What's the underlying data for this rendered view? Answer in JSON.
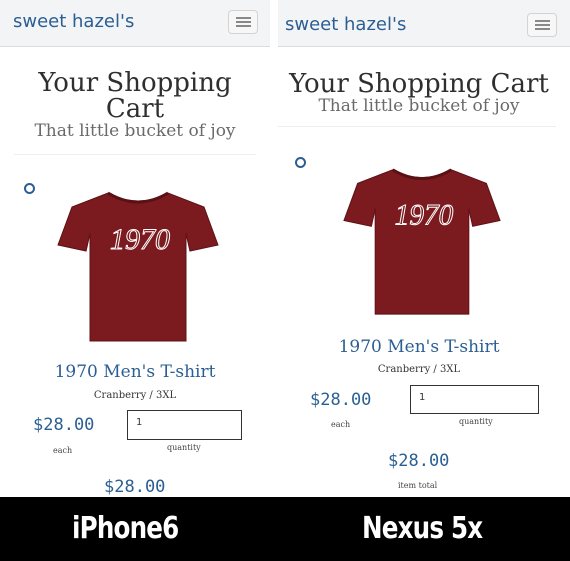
{
  "brand": "sweet hazel's",
  "cart_title": "Your Shopping Cart",
  "cart_title_line1": "Your Shopping",
  "cart_title_line2": "Cart",
  "cart_subtitle": "That little bucket of joy",
  "product": {
    "name": "1970 Men's T-shirt",
    "variant": "Cranberry / 3XL",
    "shirt_print": "1970",
    "price": "$28.00",
    "price_label": "each",
    "quantity": "1",
    "quantity_label": "quantity",
    "item_total": "$28.00",
    "item_total_label": "item total"
  },
  "colors": {
    "accent": "#2b5f93",
    "shirt": "#7b1a1f"
  },
  "icons": {
    "menu": "hamburger-icon",
    "remove": "remove-circle-icon"
  },
  "captions": {
    "left_device": "iPhone6",
    "right_device": "Nexus 5x"
  }
}
